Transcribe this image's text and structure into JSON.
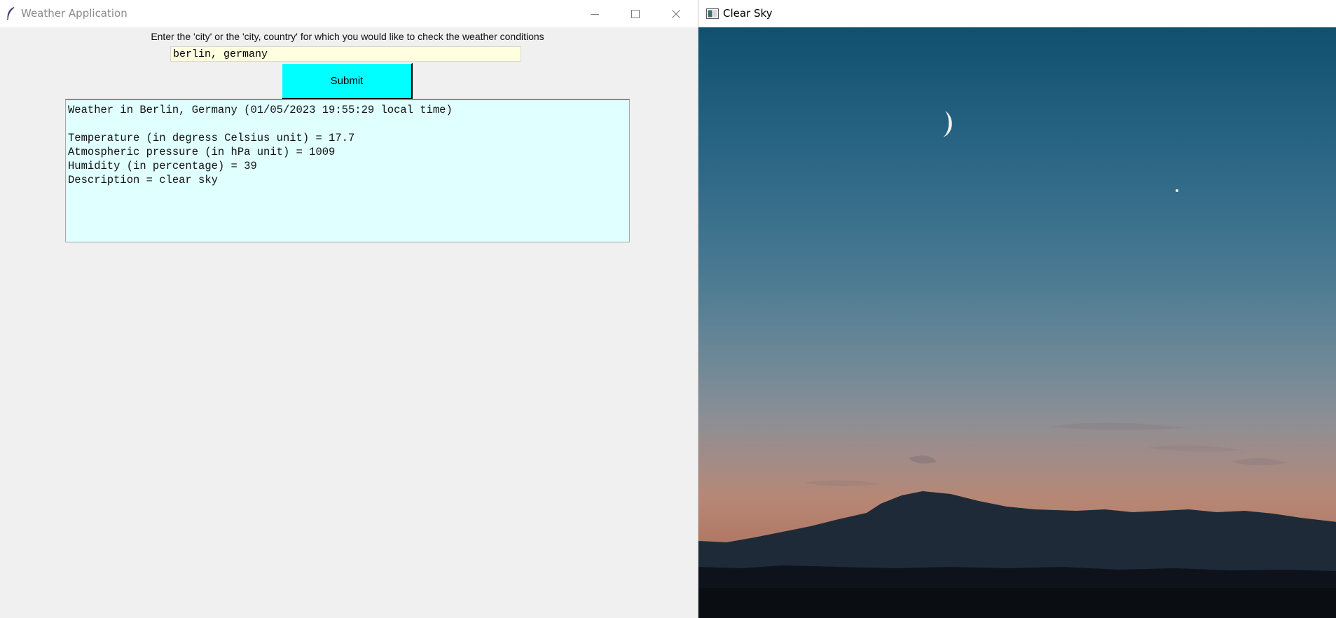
{
  "weather_window": {
    "title": "Weather Application",
    "prompt": "Enter the 'city' or the 'city, country' for which you would like to check the weather conditions",
    "city_input_value": "berlin, germany",
    "submit_label": "Submit",
    "colors": {
      "input_background": "#ffffe0",
      "submit_background": "#00ffff",
      "result_background": "#e0ffff"
    },
    "result_lines": [
      "Weather in Berlin, Germany (01/05/2023 19:55:29 local time)",
      "",
      "Temperature (in degress Celsius unit) = 17.7",
      "Atmospheric pressure (in hPa unit) = 1009",
      "Humidity (in percentage) = 39",
      "Description = clear sky"
    ]
  },
  "image_window": {
    "title": "Clear Sky"
  }
}
